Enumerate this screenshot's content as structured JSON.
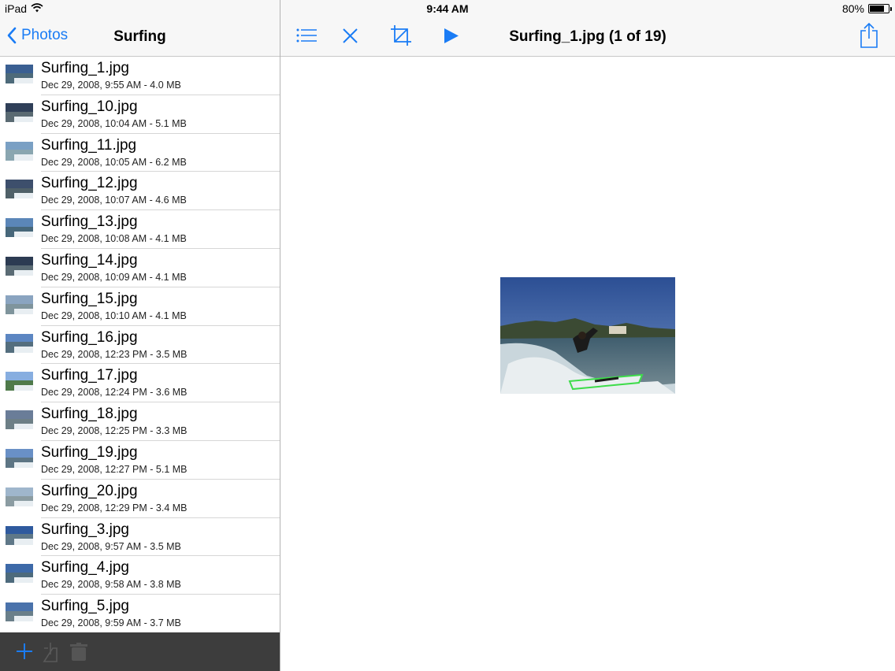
{
  "status_bar": {
    "device": "iPad",
    "time": "9:44 AM",
    "battery_percent": "80%",
    "battery_level": 0.8
  },
  "left_nav": {
    "back_label": "Photos",
    "title": "Surfing"
  },
  "files": [
    {
      "name": "Surfing_1.jpg",
      "meta": "Dec 29, 2008, 9:55 AM - 4.0 MB"
    },
    {
      "name": "Surfing_10.jpg",
      "meta": "Dec 29, 2008, 10:04 AM - 5.1 MB"
    },
    {
      "name": "Surfing_11.jpg",
      "meta": "Dec 29, 2008, 10:05 AM - 6.2 MB"
    },
    {
      "name": "Surfing_12.jpg",
      "meta": "Dec 29, 2008, 10:07 AM - 4.6 MB"
    },
    {
      "name": "Surfing_13.jpg",
      "meta": "Dec 29, 2008, 10:08 AM - 4.1 MB"
    },
    {
      "name": "Surfing_14.jpg",
      "meta": "Dec 29, 2008, 10:09 AM - 4.1 MB"
    },
    {
      "name": "Surfing_15.jpg",
      "meta": "Dec 29, 2008, 10:10 AM - 4.1 MB"
    },
    {
      "name": "Surfing_16.jpg",
      "meta": "Dec 29, 2008, 12:23 PM - 3.5 MB"
    },
    {
      "name": "Surfing_17.jpg",
      "meta": "Dec 29, 2008, 12:24 PM - 3.6 MB"
    },
    {
      "name": "Surfing_18.jpg",
      "meta": "Dec 29, 2008, 12:25 PM - 3.3 MB"
    },
    {
      "name": "Surfing_19.jpg",
      "meta": "Dec 29, 2008, 12:27 PM - 5.1 MB"
    },
    {
      "name": "Surfing_20.jpg",
      "meta": "Dec 29, 2008, 12:29 PM - 3.4 MB"
    },
    {
      "name": "Surfing_3.jpg",
      "meta": "Dec 29, 2008, 9:57 AM - 3.5 MB"
    },
    {
      "name": "Surfing_4.jpg",
      "meta": "Dec 29, 2008, 9:58 AM - 3.8 MB"
    },
    {
      "name": "Surfing_5.jpg",
      "meta": "Dec 29, 2008, 9:59 AM - 3.7 MB"
    }
  ],
  "viewer": {
    "title": "Surfing_1.jpg (1 of 19)"
  },
  "icons": {
    "list": "list-icon",
    "close": "close-icon",
    "crop": "crop-icon",
    "play": "play-icon",
    "share": "share-icon",
    "add": "add-icon",
    "move": "move-icon",
    "delete": "trash-icon"
  },
  "colors": {
    "accent": "#1a7cf5",
    "toolbar_dark": "#3d3d3d",
    "nav_bg": "#f7f7f7"
  }
}
